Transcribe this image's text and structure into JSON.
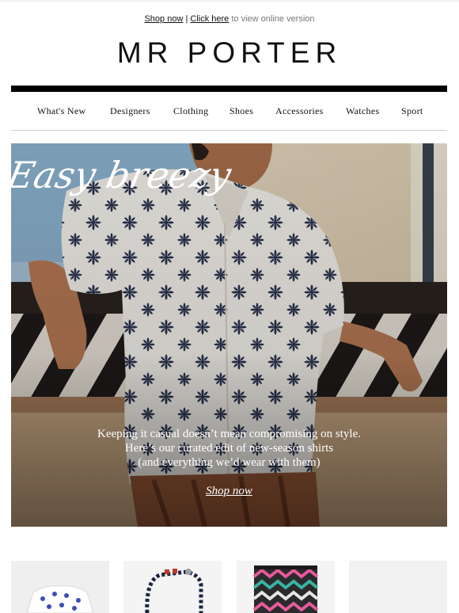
{
  "preheader": {
    "shop_now": "Shop now",
    "separator": "|",
    "click_here": "Click here",
    "rest": "to view online version"
  },
  "brand": {
    "logo": "MR PORTER"
  },
  "nav": {
    "items": [
      "What's New",
      "Designers",
      "Clothing",
      "Shoes",
      "Accessories",
      "Watches",
      "Sport"
    ]
  },
  "hero": {
    "headline": "Easy breezy",
    "body_lines": [
      "Keeping it casual doesn’t mean compromising on style.",
      "Here’s our curated edit of new-season shirts",
      "(and everything we’d wear with them)"
    ],
    "cta": "Shop now"
  },
  "products": {
    "items": [
      "printed-shirt-image",
      "beaded-necklace-image",
      "patterned-shorts-image",
      "product-image"
    ]
  },
  "colors": {
    "text": "#111111",
    "rule": "#000000",
    "hero_overlay_text": "#ffffff"
  }
}
